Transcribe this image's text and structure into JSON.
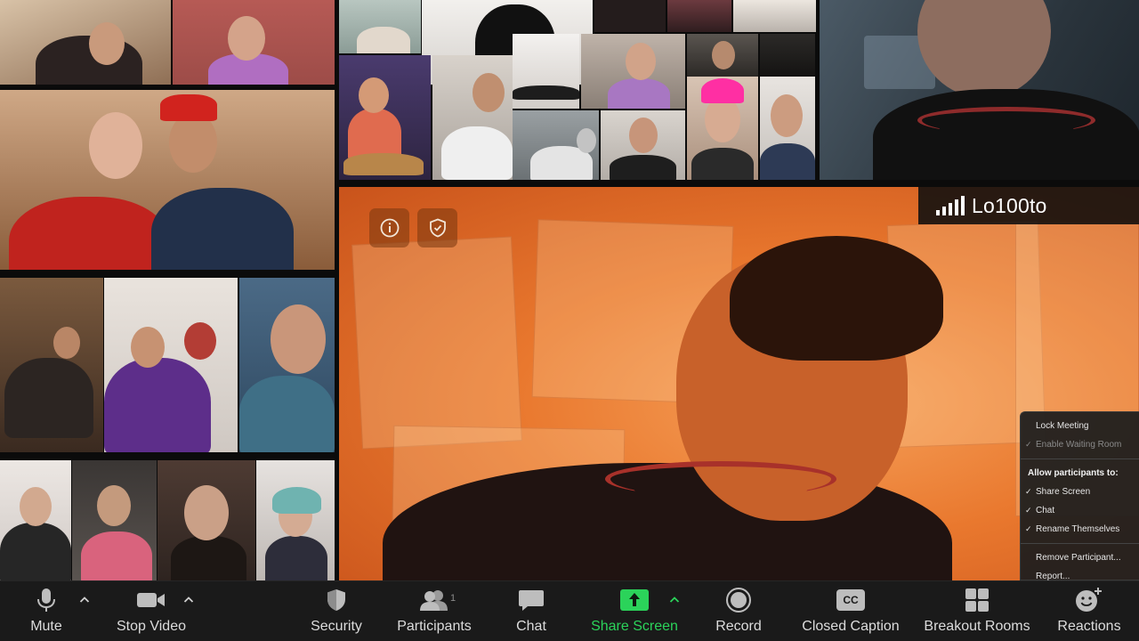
{
  "speaker": {
    "name": "Lo100to",
    "info_icon": "info-icon",
    "encryption_icon": "shield-check-icon"
  },
  "security_menu": {
    "lock_meeting": "Lock Meeting",
    "enable_waiting_room": "Enable Waiting Room",
    "allow_header": "Allow participants to:",
    "share_screen": "Share Screen",
    "chat": "Chat",
    "rename_themselves": "Rename Themselves",
    "remove_participant": "Remove Participant...",
    "report": "Report..."
  },
  "toolbar": {
    "mute": "Mute",
    "stop_video": "Stop Video",
    "security": "Security",
    "participants": "Participants",
    "participants_count": "1",
    "chat": "Chat",
    "share_screen": "Share Screen",
    "record": "Record",
    "closed_caption": "Closed Caption",
    "cc_icon_text": "CC",
    "breakout_rooms": "Breakout Rooms",
    "reactions": "Reactions"
  },
  "colors": {
    "toolbar_bg": "#1a1a1a",
    "share_green": "#2bd35a",
    "menu_bg": "#1e1e1e"
  }
}
